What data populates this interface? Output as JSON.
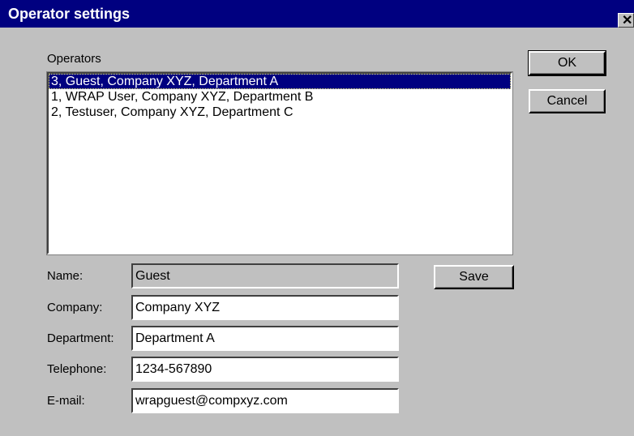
{
  "window": {
    "title": "Operator settings",
    "close_glyph": "✕"
  },
  "operators": {
    "label": "Operators",
    "items": [
      "3, Guest, Company XYZ, Department A",
      "1, WRAP User, Company XYZ, Department B",
      "2, Testuser, Company XYZ, Department C"
    ],
    "selected_index": 0
  },
  "buttons": {
    "ok": "OK",
    "cancel": "Cancel",
    "save": "Save"
  },
  "form": {
    "name": {
      "label": "Name:",
      "value": "Guest"
    },
    "company": {
      "label": "Company:",
      "value": "Company XYZ"
    },
    "department": {
      "label": "Department:",
      "value": "Department A"
    },
    "telephone": {
      "label": "Telephone:",
      "value": "1234-567890"
    },
    "email": {
      "label": "E-mail:",
      "value": "wrapguest@compxyz.com"
    }
  },
  "colors": {
    "titlebar": "#000080",
    "face": "#c0c0c0",
    "selection": "#000080"
  }
}
